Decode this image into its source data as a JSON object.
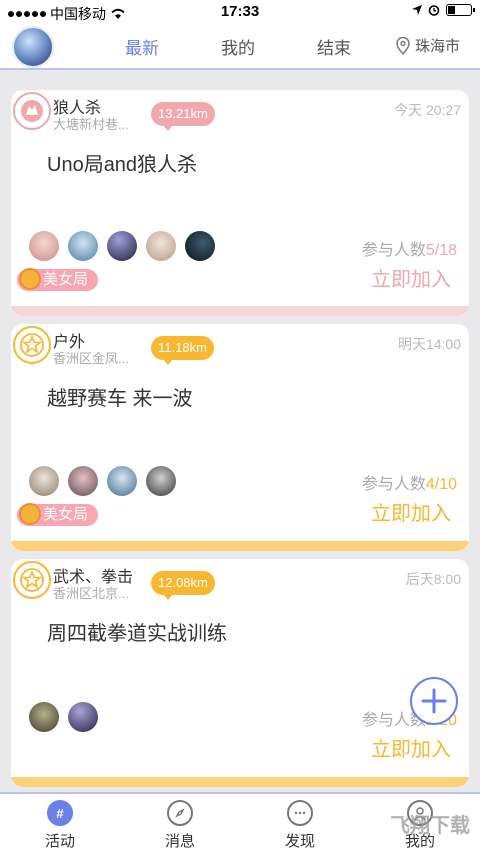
{
  "status_bar": {
    "carrier": "中国移动",
    "time": "17:33"
  },
  "nav": {
    "tabs": [
      "最新",
      "我的",
      "结束"
    ],
    "active_tab": "最新",
    "city": "珠海市"
  },
  "cards": [
    {
      "category": "狼人杀",
      "address": "大塘新村巷...",
      "distance": "13.21km",
      "time": "今天 20:27",
      "title": "Uno局and狼人杀",
      "count_label": "参与人数",
      "count": "5/18",
      "join_label": "立即加入",
      "badge": "美女局",
      "accent": "#f0a8ad"
    },
    {
      "category": "户外",
      "address": "香洲区金凤...",
      "distance": "11.18km",
      "time": "明天14:00",
      "title": "越野赛车 来一波",
      "count_label": "参与人数",
      "count": "4/10",
      "join_label": "立即加入",
      "badge": "美女局",
      "accent": "#f7b731"
    },
    {
      "category": "武术、拳击",
      "address": "香洲区北京...",
      "distance": "12.08km",
      "time": "后天8:00",
      "title": "周四截拳道实战训练",
      "count_label": "参与人数",
      "count": "2/20",
      "join_label": "立即加入",
      "accent": "#f7b731"
    }
  ],
  "bottom_nav": [
    "活动",
    "消息",
    "发现",
    "我的"
  ],
  "watermark": "飞翔下载",
  "colors": {
    "primary": "#6a80e8",
    "pink": "#f0a8ad",
    "gold": "#f7b731",
    "badge_pink": "#f7a6b2"
  }
}
